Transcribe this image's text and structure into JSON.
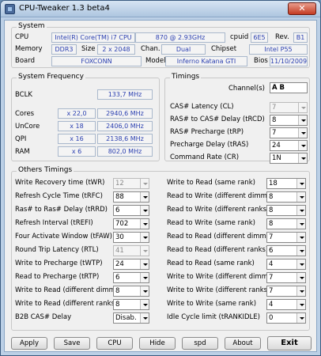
{
  "title": "CPU-Tweaker 1.3 beta4",
  "system": {
    "group": "System",
    "cpu_label": "CPU",
    "cpu_name": "Intel(R) Core(TM) i7 CPU",
    "cpu_speed": "870  @ 2.93GHz",
    "cpuid_label": "cpuid",
    "cpuid": "6E5",
    "rev_label": "Rev.",
    "rev": "B1",
    "memory_label": "Memory",
    "memory_type": "DDR3",
    "size_label": "Size",
    "size": "2 x 2048",
    "chan_label": "Chan.",
    "chan": "Dual",
    "chipset_label": "Chipset",
    "chipset": "Intel P55",
    "board_label": "Board",
    "board_vendor": "FOXCONN",
    "model_label": "Model",
    "model": "Inferno Katana GTI",
    "bios_label": "Bios",
    "bios": "11/10/2009"
  },
  "freq": {
    "group": "System Frequency",
    "bclk_label": "BCLK",
    "bclk": "133,7 MHz",
    "cores_label": "Cores",
    "cores_mult": "x 22,0",
    "cores_freq": "2940,6 MHz",
    "uncore_label": "UnCore",
    "uncore_mult": "x 18",
    "uncore_freq": "2406,0 MHz",
    "qpi_label": "QPI",
    "qpi_mult": "x 16",
    "qpi_freq": "2138,6 MHz",
    "ram_label": "RAM",
    "ram_mult": "x 6",
    "ram_freq": "802,0 MHz"
  },
  "timings": {
    "group": "Timings",
    "channel_label": "Channel(s)",
    "channel": "A  B",
    "rows": [
      {
        "label": "CAS# Latency (CL)",
        "value": "7",
        "disabled": true
      },
      {
        "label": "RAS# to CAS# Delay (tRCD)",
        "value": "8",
        "disabled": false
      },
      {
        "label": "RAS# Precharge (tRP)",
        "value": "7",
        "disabled": false
      },
      {
        "label": "Precharge Delay (tRAS)",
        "value": "24",
        "disabled": false
      },
      {
        "label": "Command Rate (CR)",
        "value": "1N",
        "disabled": false
      }
    ]
  },
  "others": {
    "group": "Others Timings",
    "left": [
      {
        "label": "Write Recovery time (tWR)",
        "value": "12",
        "disabled": true
      },
      {
        "label": "Refresh Cycle Time (tRFC)",
        "value": "88",
        "disabled": false
      },
      {
        "label": "Ras# to Ras# Delay (tRRD)",
        "value": "6",
        "disabled": false
      },
      {
        "label": "Refresh Interval (tREFI)",
        "value": "702",
        "disabled": false
      },
      {
        "label": "Four Activate Window (tFAW)",
        "value": "30",
        "disabled": false
      },
      {
        "label": "Round Trip Latency (RTL)",
        "value": "41",
        "disabled": true
      },
      {
        "label": "Write to Precharge (tWTP)",
        "value": "24",
        "disabled": false
      },
      {
        "label": "Read to Precharge (tRTP)",
        "value": "6",
        "disabled": false
      },
      {
        "label": "Write to Read (different dimms)",
        "value": "8",
        "disabled": false
      },
      {
        "label": "Write to Read (different ranks)",
        "value": "8",
        "disabled": false
      },
      {
        "label": "B2B CAS# Delay",
        "value": "Disab.",
        "disabled": false
      }
    ],
    "right": [
      {
        "label": "Write to Read (same rank)",
        "value": "18",
        "disabled": false
      },
      {
        "label": "Read to Write (different dimms)",
        "value": "8",
        "disabled": false
      },
      {
        "label": "Read to Write (different ranks)",
        "value": "8",
        "disabled": false
      },
      {
        "label": "Read to Write (same rank)",
        "value": "8",
        "disabled": false
      },
      {
        "label": "Read to Read (different dimms)",
        "value": "7",
        "disabled": false
      },
      {
        "label": "Read to Read (different ranks)",
        "value": "6",
        "disabled": false
      },
      {
        "label": "Read to Read (same rank)",
        "value": "4",
        "disabled": false
      },
      {
        "label": "Write to Write (different dimms)",
        "value": "7",
        "disabled": false
      },
      {
        "label": "Write to Write (different ranks)",
        "value": "7",
        "disabled": false
      },
      {
        "label": "Write to Write (same rank)",
        "value": "4",
        "disabled": false
      },
      {
        "label": "Idle Cycle limit (tRANKIDLE)",
        "value": "0",
        "disabled": false
      }
    ]
  },
  "buttons": {
    "apply": "Apply",
    "save": "Save",
    "cpu": "CPU",
    "hide": "Hide",
    "spd": "spd",
    "about": "About",
    "exit": "Exit"
  }
}
